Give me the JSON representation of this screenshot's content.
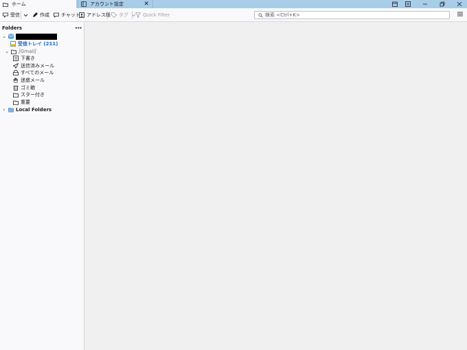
{
  "tabs": [
    {
      "label": "ホーム",
      "icon": "folder-icon",
      "active": true
    },
    {
      "label": "アカウント設定",
      "icon": "settings-page-icon",
      "active": false
    }
  ],
  "toolbar": {
    "get_messages": "受信",
    "write": "作成",
    "chat": "チャット",
    "address_book": "アドレス帳",
    "tag": "タグ",
    "quick_filter": "Quick Filter",
    "search_placeholder": "検索 <Ctrl+K>"
  },
  "sidebar": {
    "header": "Folders",
    "menu_glyph": "•••",
    "account": {
      "name_redacted": true
    },
    "folders": [
      {
        "label": "受信トレイ (211)",
        "icon": "inbox-icon",
        "style": "inbox"
      },
      {
        "label": "[Gmail]",
        "icon": "folder-icon",
        "style": "gmail"
      },
      {
        "label": "下書き",
        "icon": "drafts-icon",
        "style": "normal"
      },
      {
        "label": "送信済みメール",
        "icon": "sent-icon",
        "style": "normal"
      },
      {
        "label": "すべてのメール",
        "icon": "archive-icon",
        "style": "normal"
      },
      {
        "label": "迷惑メール",
        "icon": "spam-icon",
        "style": "normal"
      },
      {
        "label": "ゴミ箱",
        "icon": "trash-icon",
        "style": "normal"
      },
      {
        "label": "スター付き",
        "icon": "folder-icon",
        "style": "normal"
      },
      {
        "label": "重要",
        "icon": "folder-icon",
        "style": "normal"
      },
      {
        "label": "Local Folders",
        "icon": "folder-icon",
        "style": "bold"
      }
    ]
  },
  "colors": {
    "titlebar": "#a8cde6",
    "accent": "#1a66c7"
  }
}
